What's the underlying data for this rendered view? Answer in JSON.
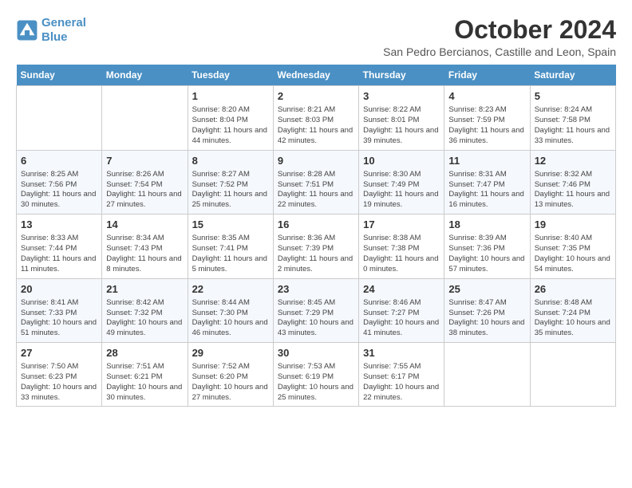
{
  "header": {
    "logo_line1": "General",
    "logo_line2": "Blue",
    "title": "October 2024",
    "subtitle": "San Pedro Bercianos, Castille and Leon, Spain"
  },
  "weekdays": [
    "Sunday",
    "Monday",
    "Tuesday",
    "Wednesday",
    "Thursday",
    "Friday",
    "Saturday"
  ],
  "weeks": [
    [
      {
        "day": "",
        "info": ""
      },
      {
        "day": "",
        "info": ""
      },
      {
        "day": "1",
        "info": "Sunrise: 8:20 AM\nSunset: 8:04 PM\nDaylight: 11 hours and 44 minutes."
      },
      {
        "day": "2",
        "info": "Sunrise: 8:21 AM\nSunset: 8:03 PM\nDaylight: 11 hours and 42 minutes."
      },
      {
        "day": "3",
        "info": "Sunrise: 8:22 AM\nSunset: 8:01 PM\nDaylight: 11 hours and 39 minutes."
      },
      {
        "day": "4",
        "info": "Sunrise: 8:23 AM\nSunset: 7:59 PM\nDaylight: 11 hours and 36 minutes."
      },
      {
        "day": "5",
        "info": "Sunrise: 8:24 AM\nSunset: 7:58 PM\nDaylight: 11 hours and 33 minutes."
      }
    ],
    [
      {
        "day": "6",
        "info": "Sunrise: 8:25 AM\nSunset: 7:56 PM\nDaylight: 11 hours and 30 minutes."
      },
      {
        "day": "7",
        "info": "Sunrise: 8:26 AM\nSunset: 7:54 PM\nDaylight: 11 hours and 27 minutes."
      },
      {
        "day": "8",
        "info": "Sunrise: 8:27 AM\nSunset: 7:52 PM\nDaylight: 11 hours and 25 minutes."
      },
      {
        "day": "9",
        "info": "Sunrise: 8:28 AM\nSunset: 7:51 PM\nDaylight: 11 hours and 22 minutes."
      },
      {
        "day": "10",
        "info": "Sunrise: 8:30 AM\nSunset: 7:49 PM\nDaylight: 11 hours and 19 minutes."
      },
      {
        "day": "11",
        "info": "Sunrise: 8:31 AM\nSunset: 7:47 PM\nDaylight: 11 hours and 16 minutes."
      },
      {
        "day": "12",
        "info": "Sunrise: 8:32 AM\nSunset: 7:46 PM\nDaylight: 11 hours and 13 minutes."
      }
    ],
    [
      {
        "day": "13",
        "info": "Sunrise: 8:33 AM\nSunset: 7:44 PM\nDaylight: 11 hours and 11 minutes."
      },
      {
        "day": "14",
        "info": "Sunrise: 8:34 AM\nSunset: 7:43 PM\nDaylight: 11 hours and 8 minutes."
      },
      {
        "day": "15",
        "info": "Sunrise: 8:35 AM\nSunset: 7:41 PM\nDaylight: 11 hours and 5 minutes."
      },
      {
        "day": "16",
        "info": "Sunrise: 8:36 AM\nSunset: 7:39 PM\nDaylight: 11 hours and 2 minutes."
      },
      {
        "day": "17",
        "info": "Sunrise: 8:38 AM\nSunset: 7:38 PM\nDaylight: 11 hours and 0 minutes."
      },
      {
        "day": "18",
        "info": "Sunrise: 8:39 AM\nSunset: 7:36 PM\nDaylight: 10 hours and 57 minutes."
      },
      {
        "day": "19",
        "info": "Sunrise: 8:40 AM\nSunset: 7:35 PM\nDaylight: 10 hours and 54 minutes."
      }
    ],
    [
      {
        "day": "20",
        "info": "Sunrise: 8:41 AM\nSunset: 7:33 PM\nDaylight: 10 hours and 51 minutes."
      },
      {
        "day": "21",
        "info": "Sunrise: 8:42 AM\nSunset: 7:32 PM\nDaylight: 10 hours and 49 minutes."
      },
      {
        "day": "22",
        "info": "Sunrise: 8:44 AM\nSunset: 7:30 PM\nDaylight: 10 hours and 46 minutes."
      },
      {
        "day": "23",
        "info": "Sunrise: 8:45 AM\nSunset: 7:29 PM\nDaylight: 10 hours and 43 minutes."
      },
      {
        "day": "24",
        "info": "Sunrise: 8:46 AM\nSunset: 7:27 PM\nDaylight: 10 hours and 41 minutes."
      },
      {
        "day": "25",
        "info": "Sunrise: 8:47 AM\nSunset: 7:26 PM\nDaylight: 10 hours and 38 minutes."
      },
      {
        "day": "26",
        "info": "Sunrise: 8:48 AM\nSunset: 7:24 PM\nDaylight: 10 hours and 35 minutes."
      }
    ],
    [
      {
        "day": "27",
        "info": "Sunrise: 7:50 AM\nSunset: 6:23 PM\nDaylight: 10 hours and 33 minutes."
      },
      {
        "day": "28",
        "info": "Sunrise: 7:51 AM\nSunset: 6:21 PM\nDaylight: 10 hours and 30 minutes."
      },
      {
        "day": "29",
        "info": "Sunrise: 7:52 AM\nSunset: 6:20 PM\nDaylight: 10 hours and 27 minutes."
      },
      {
        "day": "30",
        "info": "Sunrise: 7:53 AM\nSunset: 6:19 PM\nDaylight: 10 hours and 25 minutes."
      },
      {
        "day": "31",
        "info": "Sunrise: 7:55 AM\nSunset: 6:17 PM\nDaylight: 10 hours and 22 minutes."
      },
      {
        "day": "",
        "info": ""
      },
      {
        "day": "",
        "info": ""
      }
    ]
  ]
}
